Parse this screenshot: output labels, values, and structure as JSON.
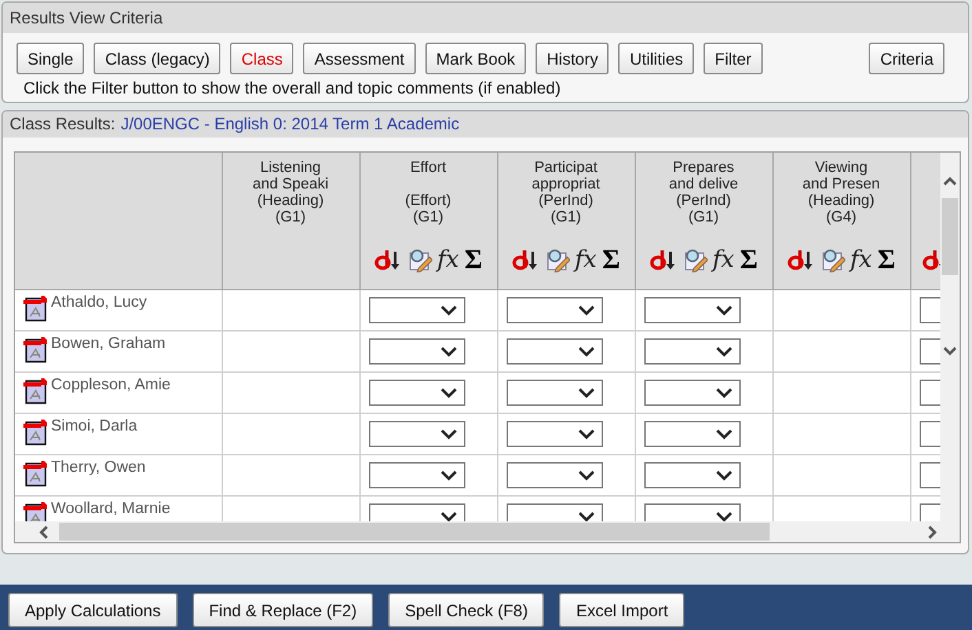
{
  "criteria_panel": {
    "title": "Results View Criteria",
    "buttons": [
      {
        "label": "Single",
        "selected": false
      },
      {
        "label": "Class (legacy)",
        "selected": false
      },
      {
        "label": "Class",
        "selected": true
      },
      {
        "label": "Assessment",
        "selected": false
      },
      {
        "label": "Mark Book",
        "selected": false
      },
      {
        "label": "History",
        "selected": false
      },
      {
        "label": "Utilities",
        "selected": false
      },
      {
        "label": "Filter",
        "selected": false
      }
    ],
    "criteria_button": "Criteria",
    "hint": "Click the Filter button to show the overall and topic comments (if enabled)"
  },
  "results_panel": {
    "title_label": "Class Results:",
    "class_name": "J/00ENGC - English 0: 2014 Term 1 Academic",
    "columns": [
      {
        "kind": "heading",
        "title_lines": [
          "Listening",
          "and Speaki"
        ],
        "type": "(Heading)",
        "group": "(G1)"
      },
      {
        "kind": "graded",
        "title_lines": [
          "Effort"
        ],
        "type": "(Effort)",
        "group": "(G1)",
        "tools": [
          "fx",
          "Σ"
        ]
      },
      {
        "kind": "graded",
        "title_lines": [
          "Participat",
          "appropriat"
        ],
        "type": "(PerInd)",
        "group": "(G1)",
        "tools": [
          "fx",
          "Σ"
        ]
      },
      {
        "kind": "graded",
        "title_lines": [
          "Prepares",
          "and delive"
        ],
        "type": "(PerInd)",
        "group": "(G1)",
        "tools": [
          "fx",
          "Σ"
        ]
      },
      {
        "kind": "heading",
        "title_lines": [
          "Viewing",
          "and Presen"
        ],
        "type": "(Heading)",
        "group": "(G4)",
        "tools": [
          "fx",
          "Σ"
        ]
      },
      {
        "kind": "cut_off"
      }
    ],
    "rows": [
      {
        "name": "Athaldo, Lucy"
      },
      {
        "name": "Bowen, Graham"
      },
      {
        "name": "Coppleson, Amie"
      },
      {
        "name": "Simoi, Darla"
      },
      {
        "name": "Therry, Owen"
      },
      {
        "name": "Woollard, Marnie"
      }
    ]
  },
  "action_bar": {
    "buttons": [
      "Apply Calculations",
      "Find & Replace (F2)",
      "Spell Check (F8)",
      "Excel Import"
    ]
  }
}
